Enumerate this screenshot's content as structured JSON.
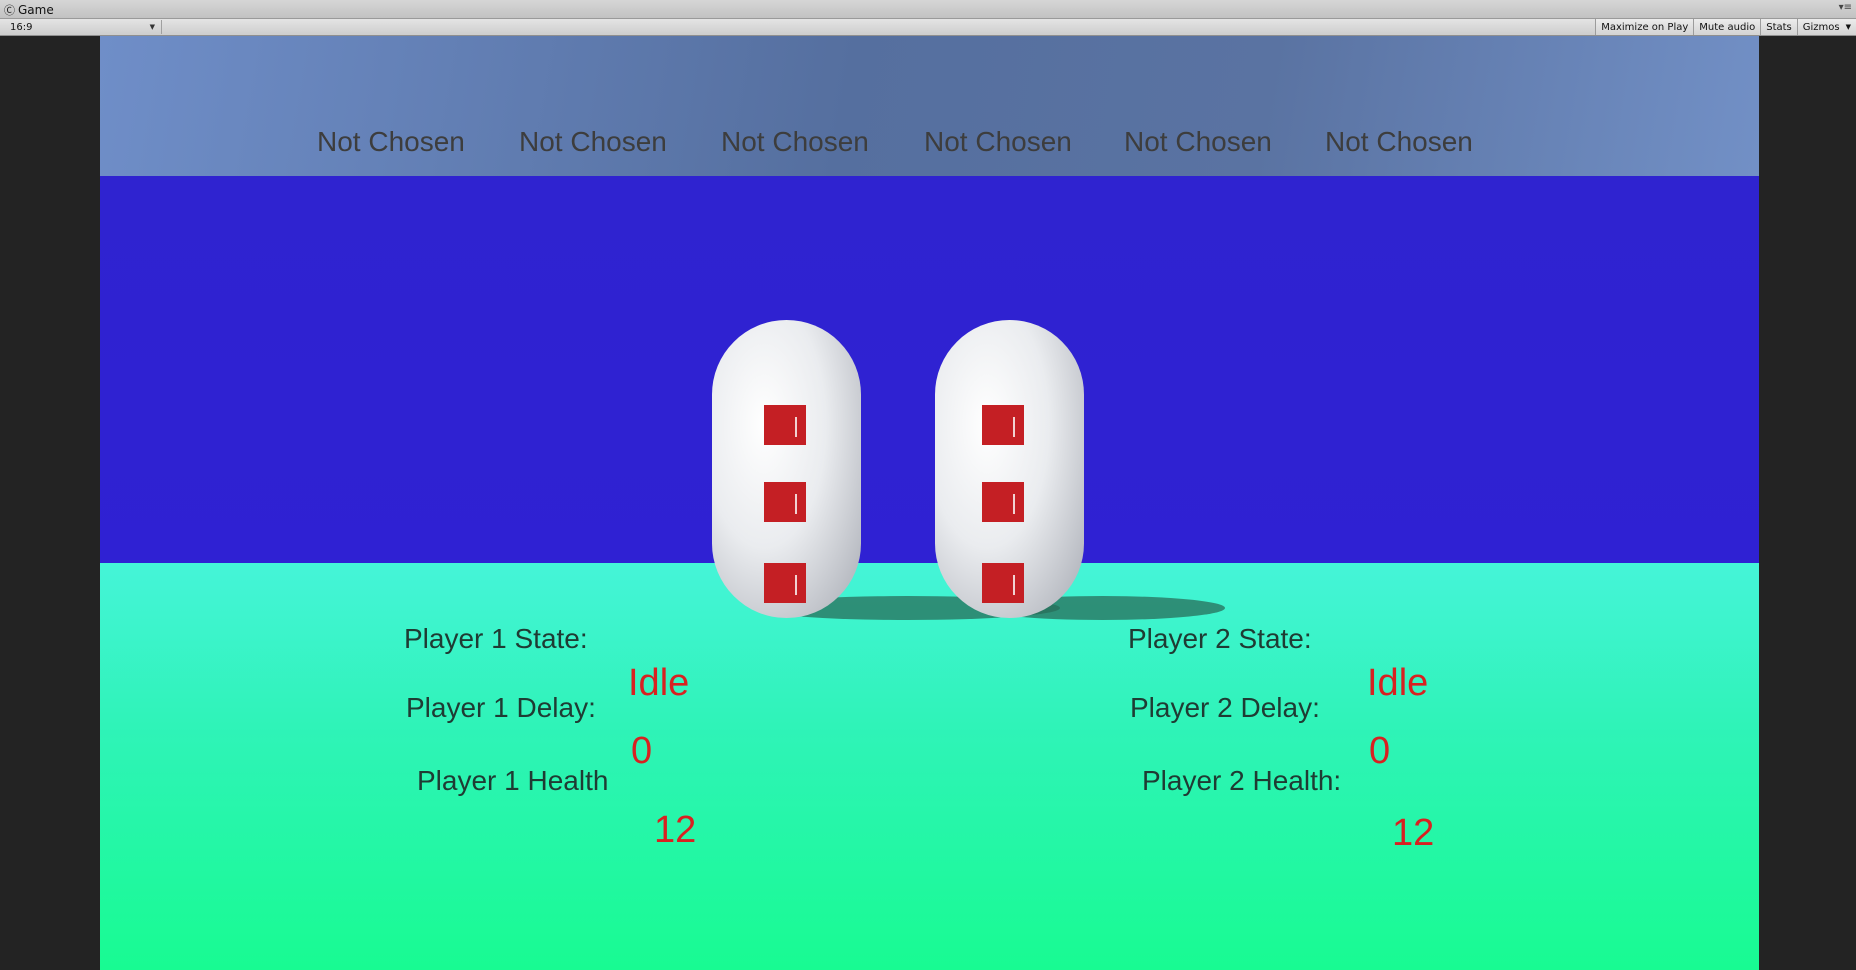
{
  "window": {
    "tab_title": "Game",
    "tab_icon": "game-controller-icon",
    "pane_menu_icon": "pane-menu-icon"
  },
  "toolbar": {
    "aspect": "16:9",
    "maximize_on_play": "Maximize on Play",
    "mute_audio": "Mute audio",
    "stats": "Stats",
    "gizmos": "Gizmos"
  },
  "choices": [
    "Not Chosen",
    "Not Chosen",
    "Not Chosen",
    "Not Chosen",
    "Not Chosen",
    "Not Chosen"
  ],
  "player1": {
    "state_label": "Player 1 State:",
    "state": "Idle",
    "delay_label": "Player 1 Delay:",
    "delay": "0",
    "health_label": "Player 1 Health",
    "health": "12"
  },
  "player2": {
    "state_label": "Player 2 State:",
    "state": "Idle",
    "delay_label": "Player 2 Delay:",
    "delay": "0",
    "health_label": "Player 2 Health:",
    "health": "12"
  },
  "colors": {
    "sky": "#2f23d0",
    "ground": "#2ff3b8",
    "value_text": "#d82121",
    "player_body": "#e8e9ec",
    "player_marks": "#c41f24"
  }
}
